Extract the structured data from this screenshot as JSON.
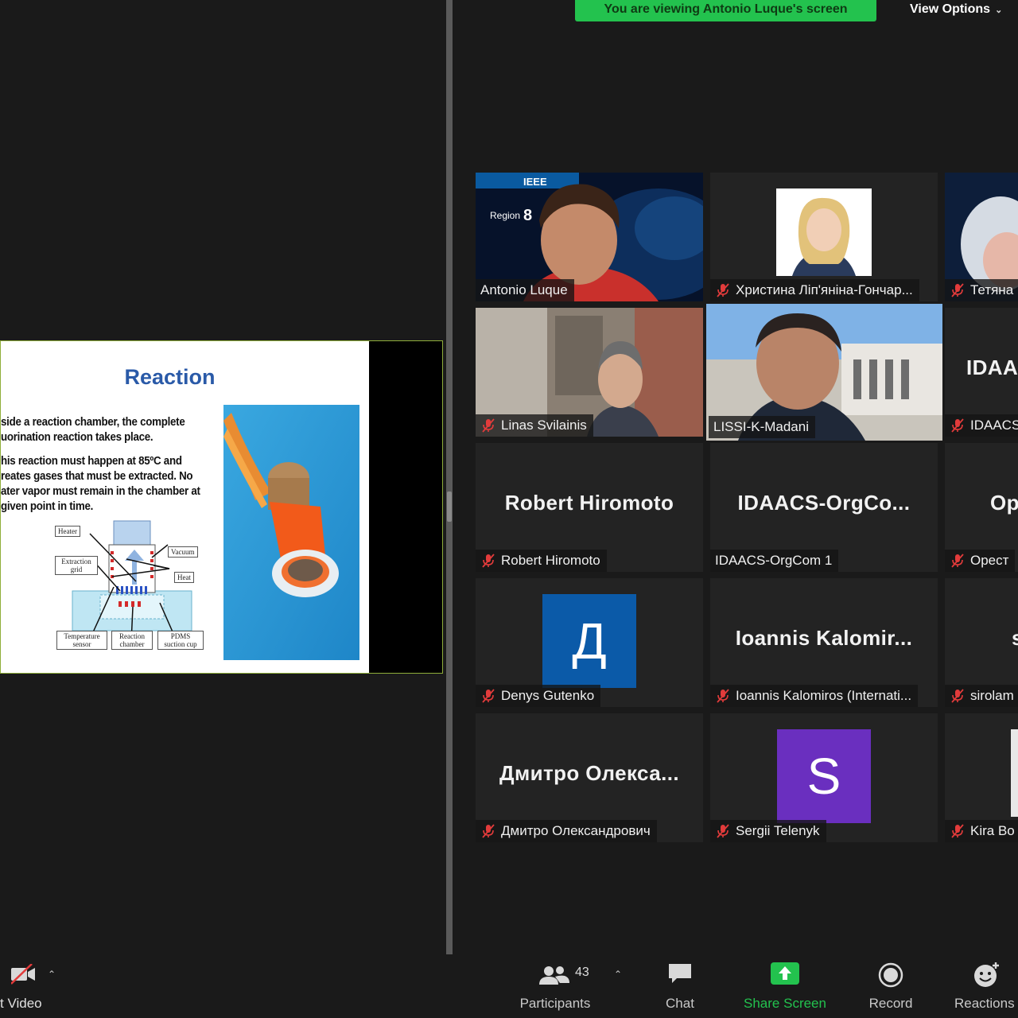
{
  "banner": {
    "text": "You are viewing Antonio Luque's screen"
  },
  "view_options": {
    "label": "View Options"
  },
  "slide": {
    "title": "Reaction",
    "para1": [
      "side a reaction chamber, the complete",
      "uorination reaction takes place."
    ],
    "para2": [
      "his reaction must happen at 85ºC and",
      "reates gases that must be extracted. No",
      "ater vapor must remain in the chamber at",
      " given point in time."
    ],
    "diagram_labels": {
      "heater": "Heater",
      "vacuum": "Vacuum",
      "extraction_grid": "Extraction grid",
      "heat": "Heat",
      "temperature_sensor": "Temperature sensor",
      "reaction_chamber": "Reaction chamber",
      "pdms": "PDMS suction cup"
    }
  },
  "tiles": [
    {
      "id": "antonio",
      "big_name": "",
      "nameplate": "Antonio Luque",
      "muted": false
    },
    {
      "id": "khrystyna",
      "big_name": "",
      "nameplate": "Христина Ліп'яніна-Гончар...",
      "muted": true
    },
    {
      "id": "tetyana",
      "big_name": "",
      "nameplate": "Тетяна",
      "muted": true
    },
    {
      "id": "linas",
      "big_name": "",
      "nameplate": "Linas Svilainis",
      "muted": true
    },
    {
      "id": "lissi",
      "big_name": "",
      "nameplate": "LISSI-K-Madani",
      "muted": false
    },
    {
      "id": "idaacs-r",
      "big_name": "IDAA",
      "nameplate": "IDAACS",
      "muted": true
    },
    {
      "id": "robert",
      "big_name": "Robert Hiromoto",
      "nameplate": "Robert Hiromoto",
      "muted": true
    },
    {
      "id": "idaacs-orgcom",
      "big_name": "IDAACS-OrgCo...",
      "nameplate": "IDAACS-OrgCom 1",
      "muted": false
    },
    {
      "id": "orest",
      "big_name": "Op",
      "nameplate": "Орест",
      "muted": true
    },
    {
      "id": "denys",
      "big_name": "",
      "avatar_letter": "Д",
      "nameplate": "Denys Gutenko",
      "muted": true
    },
    {
      "id": "ioannis",
      "big_name": "Ioannis  Kalomir...",
      "nameplate": "Ioannis Kalomiros (Internati...",
      "muted": true
    },
    {
      "id": "sirolam",
      "big_name": "s",
      "nameplate": "sirolam",
      "muted": true
    },
    {
      "id": "dmytro",
      "big_name": "Дмитро  Олекса...",
      "nameplate": "Дмитро Олександрович",
      "muted": true
    },
    {
      "id": "sergii",
      "big_name": "",
      "avatar_letter": "S",
      "nameplate": "Sergii Telenyk",
      "muted": true
    },
    {
      "id": "kira",
      "big_name": "",
      "nameplate": "Kira Bo",
      "muted": true
    }
  ],
  "toolbar": {
    "video_label": "t Video",
    "participants_label": "Participants",
    "participants_count": "43",
    "chat_label": "Chat",
    "share_label": "Share Screen",
    "record_label": "Record",
    "reactions_label": "Reactions"
  },
  "colors": {
    "share_green": "#23c24e",
    "active_speaker": "#d8df62",
    "denys_avatar": "#0b5aa8",
    "sergii_avatar": "#6a2fbf"
  }
}
